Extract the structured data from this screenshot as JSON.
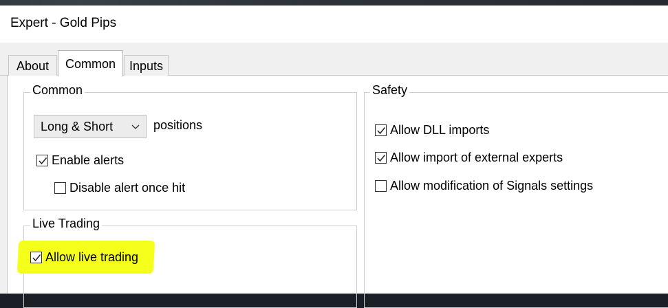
{
  "window": {
    "title": "Expert - Gold Pips"
  },
  "tabs": [
    {
      "label": "About",
      "active": false
    },
    {
      "label": "Common",
      "active": true
    },
    {
      "label": "Inputs",
      "active": false
    }
  ],
  "common": {
    "group_title": "Common",
    "positions_select": {
      "value": "Long & Short",
      "suffix": "positions"
    },
    "enable_alerts": {
      "label": "Enable alerts",
      "checked": true
    },
    "disable_alert_once_hit": {
      "label": "Disable alert once hit",
      "checked": false
    }
  },
  "live_trading": {
    "group_title": "Live Trading",
    "allow_live_trading": {
      "label": "Allow live trading",
      "checked": true
    },
    "highlight_color": "#f5ff1c"
  },
  "safety": {
    "group_title": "Safety",
    "allow_dll_imports": {
      "label": "Allow DLL imports",
      "checked": true
    },
    "allow_external_experts": {
      "label": "Allow import of external experts",
      "checked": true
    },
    "allow_signals_modification": {
      "label": "Allow modification of Signals settings",
      "checked": false
    }
  }
}
